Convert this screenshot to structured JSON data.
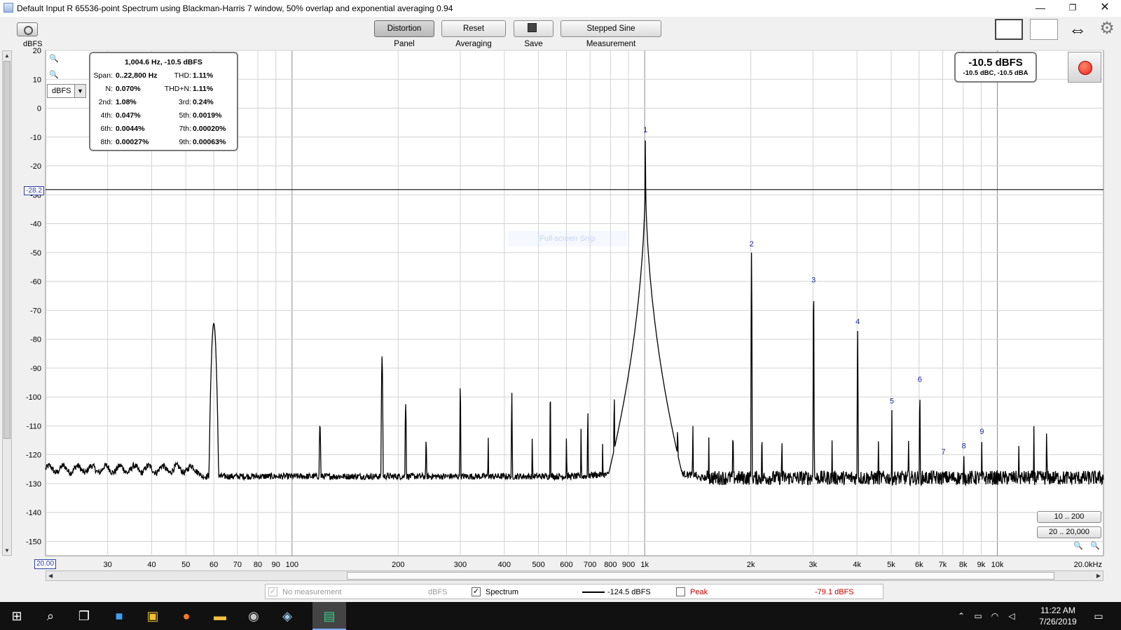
{
  "window": {
    "title": "Default Input R 65536-point Spectrum using Blackman-Harris 7 window, 50% overlap and exponential averaging 0.94",
    "min_glyph": "—",
    "max_glyph": "❐",
    "close_glyph": "✕"
  },
  "toolbar": {
    "distortion_label": "Distortion Panel",
    "reset_label": "Reset Averaging",
    "save_label": "Save",
    "stepped_label": "Stepped Sine Measurement",
    "icons": [
      "camera-icon",
      "view-icon",
      "columns-icon",
      "move-icon",
      "gear-icon"
    ]
  },
  "overlays": {
    "unit_label": "dBFS",
    "unit_select": "dBFS",
    "cursor_y": "-28.2",
    "cursor_x": "20.00",
    "snip_hint": "Full-screen Snip",
    "level_main": "-10.5 dBFS",
    "level_sub": "-10.5 dBC, -10.5 dBA",
    "range_low": "10 .. 200",
    "range_high": "20 .. 20,000"
  },
  "distortion_panel": {
    "header": "1,004.6 Hz, -10.5 dBFS",
    "rows": [
      {
        "l1": "Span:",
        "v1": "0..22,800 Hz",
        "l2": "THD:",
        "v2": "1.11%"
      },
      {
        "l1": "N:",
        "v1": "0.070%",
        "l2": "THD+N:",
        "v2": "1.11%"
      },
      {
        "l1": "2nd:",
        "v1": "1.08%",
        "l2": "3rd:",
        "v2": "0.24%"
      },
      {
        "l1": "4th:",
        "v1": "0.047%",
        "l2": "5th:",
        "v2": "0.0019%"
      },
      {
        "l1": "6th:",
        "v1": "0.0044%",
        "l2": "7th:",
        "v2": "0.00020%"
      },
      {
        "l1": "8th:",
        "v1": "0.00027%",
        "l2": "9th:",
        "v2": "0.00063%"
      }
    ]
  },
  "legend": {
    "no_measurement": "No measurement",
    "no_measurement_unit": "dBFS",
    "spectrum_label": "Spectrum",
    "spectrum_value": "-124.5 dBFS",
    "peak_label": "Peak",
    "peak_value": "-79.1 dBFS",
    "peak_color": "#c00000"
  },
  "taskbar": {
    "time": "11:22 AM",
    "date": "7/26/2019"
  },
  "chart_data": {
    "type": "line",
    "x_scale": "log",
    "xlim": [
      20,
      20000
    ],
    "ylim": [
      -155,
      20
    ],
    "y_unit": "dBFS",
    "y_ticks": [
      20,
      10,
      0,
      -10,
      -20,
      -30,
      -40,
      -50,
      -60,
      -70,
      -80,
      -90,
      -100,
      -110,
      -120,
      -130,
      -140,
      -150
    ],
    "x_ticks": [
      {
        "f": 30,
        "label": "30"
      },
      {
        "f": 40,
        "label": "40"
      },
      {
        "f": 50,
        "label": "50"
      },
      {
        "f": 60,
        "label": "60"
      },
      {
        "f": 70,
        "label": "70"
      },
      {
        "f": 80,
        "label": "80"
      },
      {
        "f": 90,
        "label": "90"
      },
      {
        "f": 100,
        "label": "100"
      },
      {
        "f": 200,
        "label": "200"
      },
      {
        "f": 300,
        "label": "300"
      },
      {
        "f": 400,
        "label": "400"
      },
      {
        "f": 500,
        "label": "500"
      },
      {
        "f": 600,
        "label": "600"
      },
      {
        "f": 700,
        "label": "700"
      },
      {
        "f": 800,
        "label": "800"
      },
      {
        "f": 900,
        "label": "900"
      },
      {
        "f": 1000,
        "label": "1k"
      },
      {
        "f": 2000,
        "label": "2k"
      },
      {
        "f": 3000,
        "label": "3k"
      },
      {
        "f": 4000,
        "label": "4k"
      },
      {
        "f": 5000,
        "label": "5k"
      },
      {
        "f": 6000,
        "label": "6k"
      },
      {
        "f": 7000,
        "label": "7k"
      },
      {
        "f": 8000,
        "label": "8k"
      },
      {
        "f": 9000,
        "label": "9k"
      },
      {
        "f": 10000,
        "label": "10k"
      },
      {
        "f": 20000,
        "label": "20.0kHz"
      }
    ],
    "cursor_level": -28.2,
    "noise_floor": -126,
    "series": [
      {
        "color": "#000000",
        "peaks": [
          {
            "f": 60,
            "level": -74.5,
            "width": 0.012
          },
          {
            "f": 120,
            "level": -109.5,
            "width": 0.004
          },
          {
            "f": 180,
            "level": -86,
            "width": 0.003
          },
          {
            "f": 210,
            "level": -102.5,
            "width": 0.003
          },
          {
            "f": 240,
            "level": -115,
            "width": 0.003
          },
          {
            "f": 300,
            "level": -96,
            "width": 0.002
          },
          {
            "f": 360,
            "level": -114,
            "width": 0.002
          },
          {
            "f": 420,
            "level": -98.5,
            "width": 0.002
          },
          {
            "f": 480,
            "level": -114,
            "width": 0.002
          },
          {
            "f": 540,
            "level": -98.5,
            "width": 0.002
          },
          {
            "f": 600,
            "level": -114,
            "width": 0.002
          },
          {
            "f": 660,
            "level": -111,
            "width": 0.002
          },
          {
            "f": 690,
            "level": -105,
            "width": 0.002
          },
          {
            "f": 760,
            "level": -116,
            "width": 0.002
          },
          {
            "f": 820,
            "level": -100,
            "width": 0.002
          },
          {
            "f": 880,
            "level": -112,
            "width": 0.002
          },
          {
            "f": 960,
            "level": -98,
            "width": 0.002
          },
          {
            "f": 1004.6,
            "level": -10.5,
            "width": 0.0015
          },
          {
            "f": 1040,
            "level": -93,
            "width": 0.002
          },
          {
            "f": 1120,
            "level": -110,
            "width": 0.002
          },
          {
            "f": 1240,
            "level": -110,
            "width": 0.002
          },
          {
            "f": 1370,
            "level": -110,
            "width": 0.002
          },
          {
            "f": 1520,
            "level": -114,
            "width": 0.002
          },
          {
            "f": 1780,
            "level": -112,
            "width": 0.002
          },
          {
            "f": 2009,
            "level": -50,
            "width": 0.0015
          },
          {
            "f": 2150,
            "level": -113,
            "width": 0.002
          },
          {
            "f": 2450,
            "level": -115,
            "width": 0.002
          },
          {
            "f": 3013,
            "level": -62.5,
            "width": 0.0015
          },
          {
            "f": 3400,
            "level": -115,
            "width": 0.002
          },
          {
            "f": 4018,
            "level": -77,
            "width": 0.0015
          },
          {
            "f": 4600,
            "level": -115,
            "width": 0.002
          },
          {
            "f": 5023,
            "level": -104.5,
            "width": 0.0015
          },
          {
            "f": 5600,
            "level": -115,
            "width": 0.002
          },
          {
            "f": 6028,
            "level": -97,
            "width": 0.0015
          },
          {
            "f": 7032,
            "level": -122,
            "width": 0.0015
          },
          {
            "f": 8037,
            "level": -120,
            "width": 0.0015
          },
          {
            "f": 9041,
            "level": -115,
            "width": 0.0015
          },
          {
            "f": 12700,
            "level": -110,
            "width": 0.0015
          },
          {
            "f": 13800,
            "level": -110,
            "width": 0.0015
          },
          {
            "f": 11500,
            "level": -115,
            "width": 0.0015
          }
        ]
      }
    ],
    "markers": [
      {
        "label": "1",
        "f": 1004.6,
        "level": -10.5
      },
      {
        "label": "2",
        "f": 2009,
        "level": -50
      },
      {
        "label": "3",
        "f": 3013,
        "level": -62.5
      },
      {
        "label": "4",
        "f": 4018,
        "level": -77
      },
      {
        "label": "5",
        "f": 5023,
        "level": -104.5
      },
      {
        "label": "6",
        "f": 6028,
        "level": -97
      },
      {
        "label": "7",
        "f": 7032,
        "level": -122
      },
      {
        "label": "8",
        "f": 8037,
        "level": -120
      },
      {
        "label": "9",
        "f": 9041,
        "level": -115
      }
    ]
  }
}
